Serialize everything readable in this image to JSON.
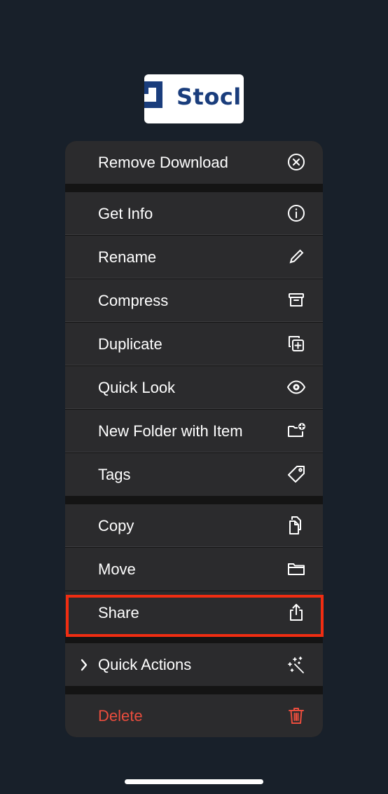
{
  "thumbnail": {
    "text": "Stocl"
  },
  "menu": {
    "remove_download": {
      "label": "Remove Download",
      "icon": "x-circle-icon"
    },
    "get_info": {
      "label": "Get Info",
      "icon": "info-circle-icon"
    },
    "rename": {
      "label": "Rename",
      "icon": "pencil-icon"
    },
    "compress": {
      "label": "Compress",
      "icon": "archive-box-icon"
    },
    "duplicate": {
      "label": "Duplicate",
      "icon": "duplicate-plus-icon"
    },
    "quick_look": {
      "label": "Quick Look",
      "icon": "eye-icon"
    },
    "new_folder": {
      "label": "New Folder with Item",
      "icon": "folder-plus-icon"
    },
    "tags": {
      "label": "Tags",
      "icon": "tag-icon"
    },
    "copy": {
      "label": "Copy",
      "icon": "copy-docs-icon"
    },
    "move": {
      "label": "Move",
      "icon": "folder-icon"
    },
    "share": {
      "label": "Share",
      "icon": "share-icon"
    },
    "quick_actions": {
      "label": "Quick Actions",
      "icon": "sparkles-icon"
    },
    "delete": {
      "label": "Delete",
      "icon": "trash-icon"
    }
  },
  "colors": {
    "background": "#18202a",
    "menu_row": "#2b2b2d",
    "destructive": "#eb4d3d",
    "highlight_border": "#f02d12"
  }
}
